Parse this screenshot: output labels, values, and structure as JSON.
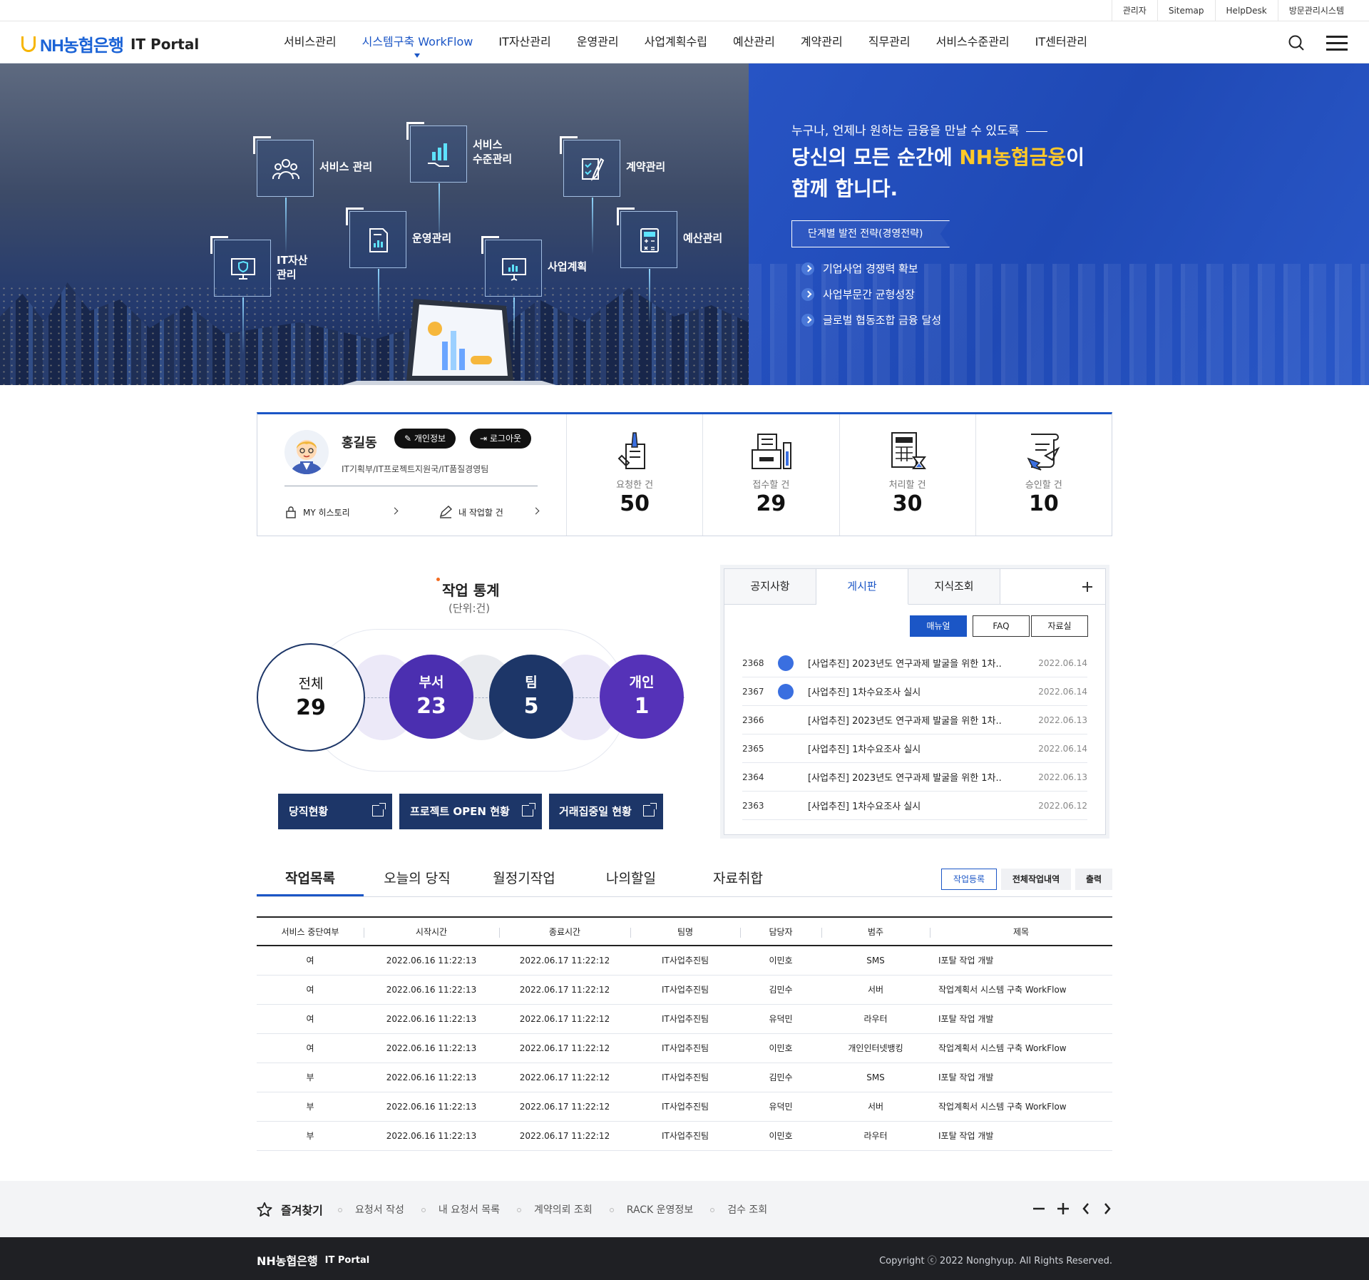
{
  "util_links": [
    "관리자",
    "Sitemap",
    "HelpDesk",
    "방문관리시스템"
  ],
  "logo": {
    "brand": "NH농협은행",
    "product": "IT Portal"
  },
  "nav": {
    "items": [
      "서비스관리",
      "시스템구축 WorkFlow",
      "IT자산관리",
      "운영관리",
      "사업계획수립",
      "예산관리",
      "계약관리",
      "직무관리",
      "서비스수준관리",
      "IT센터관리"
    ],
    "active": "시스템구축 WorkFlow"
  },
  "hero": {
    "tiles": {
      "service": "서비스 관리",
      "sla_1": "서비스",
      "sla_2": "수준관리",
      "contract": "계약관리",
      "ops": "운영관리",
      "budget": "예산관리",
      "asset_1": "IT자산",
      "asset_2": "관리",
      "plan": "사업계획"
    },
    "subtitle": "누구나, 언제나 원하는 금융을 만날 수 있도록",
    "title_1": "당신의 모든 순간에 ",
    "title_highlight": "NH농협금융",
    "title_2": "이",
    "title_3": "함께 합니다.",
    "tag": "단계별 발전 전략(경영전략)",
    "points": [
      "기업사업 경쟁력 확보",
      "사업부문간 균형성장",
      "글로벌 협동조합 금융 달성"
    ]
  },
  "user": {
    "name": "홍길동",
    "profile_btn": "개인정보",
    "logout_btn": "로그아웃",
    "dept": "IT기획부/IT프로젝트지원국/IT품질경영팀",
    "my_history": "MY 히스토리",
    "my_tasks": "내 작업할 건"
  },
  "stats": [
    {
      "label": "요청한 건",
      "value": "50"
    },
    {
      "label": "접수할 건",
      "value": "29"
    },
    {
      "label": "처리할 건",
      "value": "30"
    },
    {
      "label": "승인할 건",
      "value": "10"
    }
  ],
  "work_stats": {
    "title": "작업 통계",
    "unit": "(단위:건)",
    "total_label": "전체",
    "total": "29",
    "dept_label": "부서",
    "dept": "23",
    "team_label": "팀",
    "team": "5",
    "personal_label": "개인",
    "personal": "1"
  },
  "quick_buttons": [
    "당직현황",
    "프로젝트 OPEN 현황",
    "거래집중일 현황"
  ],
  "board": {
    "tabs": [
      "공지사항",
      "게시판",
      "지식조회"
    ],
    "active_tab": "게시판",
    "sub_buttons": [
      "매뉴얼",
      "FAQ",
      "자료실"
    ],
    "rows": [
      {
        "no": "2368",
        "title": "[사업추진] 2023년도 연구과제 발굴을 위한 1차..",
        "date": "2022.06.14",
        "icon": true
      },
      {
        "no": "2367",
        "title": "[사업추진] 1차수요조사 실시",
        "date": "2022.06.14",
        "icon": true
      },
      {
        "no": "2366",
        "title": "[사업추진] 2023년도 연구과제 발굴을 위한 1차..",
        "date": "2022.06.13",
        "icon": false
      },
      {
        "no": "2365",
        "title": "[사업추진] 1차수요조사 실시",
        "date": "2022.06.14",
        "icon": false
      },
      {
        "no": "2364",
        "title": "[사업추진] 2023년도 연구과제 발굴을 위한 1차..",
        "date": "2022.06.13",
        "icon": false
      },
      {
        "no": "2363",
        "title": "[사업추진] 1차수요조사 실시",
        "date": "2022.06.12",
        "icon": false
      }
    ]
  },
  "work_tabs": [
    "작업목록",
    "오늘의 당직",
    "월정기작업",
    "나의할일",
    "자료취합"
  ],
  "work_buttons": [
    "작업등록",
    "전체작업내역",
    "출력"
  ],
  "table": {
    "headers": [
      "서비스 중단여부",
      "시작시간",
      "종료시간",
      "팀명",
      "담당자",
      "범주",
      "제목"
    ],
    "rows": [
      [
        "여",
        "2022.06.16 11:22:13",
        "2022.06.17 11:22:12",
        "IT사업추진팀",
        "이민호",
        "SMS",
        "I포탈 작업 개발"
      ],
      [
        "여",
        "2022.06.16 11:22:13",
        "2022.06.17 11:22:12",
        "IT사업추진팀",
        "김민수",
        "서버",
        "작업계획서 시스템 구축 WorkFlow"
      ],
      [
        "여",
        "2022.06.16 11:22:13",
        "2022.06.17 11:22:12",
        "IT사업추진팀",
        "유덕민",
        "라우터",
        "I포탈 작업 개발"
      ],
      [
        "여",
        "2022.06.16 11:22:13",
        "2022.06.17 11:22:12",
        "IT사업추진팀",
        "이민호",
        "개인인터넷뱅킹",
        "작업계획서 시스템 구축 WorkFlow"
      ],
      [
        "부",
        "2022.06.16 11:22:13",
        "2022.06.17 11:22:12",
        "IT사업추진팀",
        "김민수",
        "SMS",
        "I포탈 작업 개발"
      ],
      [
        "부",
        "2022.06.16 11:22:13",
        "2022.06.17 11:22:12",
        "IT사업추진팀",
        "유덕민",
        "서버",
        "작업계획서 시스템 구축 WorkFlow"
      ],
      [
        "부",
        "2022.06.16 11:22:13",
        "2022.06.17 11:22:12",
        "IT사업추진팀",
        "이민호",
        "라우터",
        "I포탈 작업 개발"
      ]
    ]
  },
  "favorites": {
    "title": "즐겨찾기",
    "items": [
      "요청서 작성",
      "내 요청서 목록",
      "계약의뢰 조회",
      "RACK 운영정보",
      "검수 조회"
    ]
  },
  "footer": {
    "brand": "NH농협은행",
    "product": "IT Portal",
    "copyright": "Copyright ⓒ 2022 Nonghyup. All Rights Reserved."
  }
}
